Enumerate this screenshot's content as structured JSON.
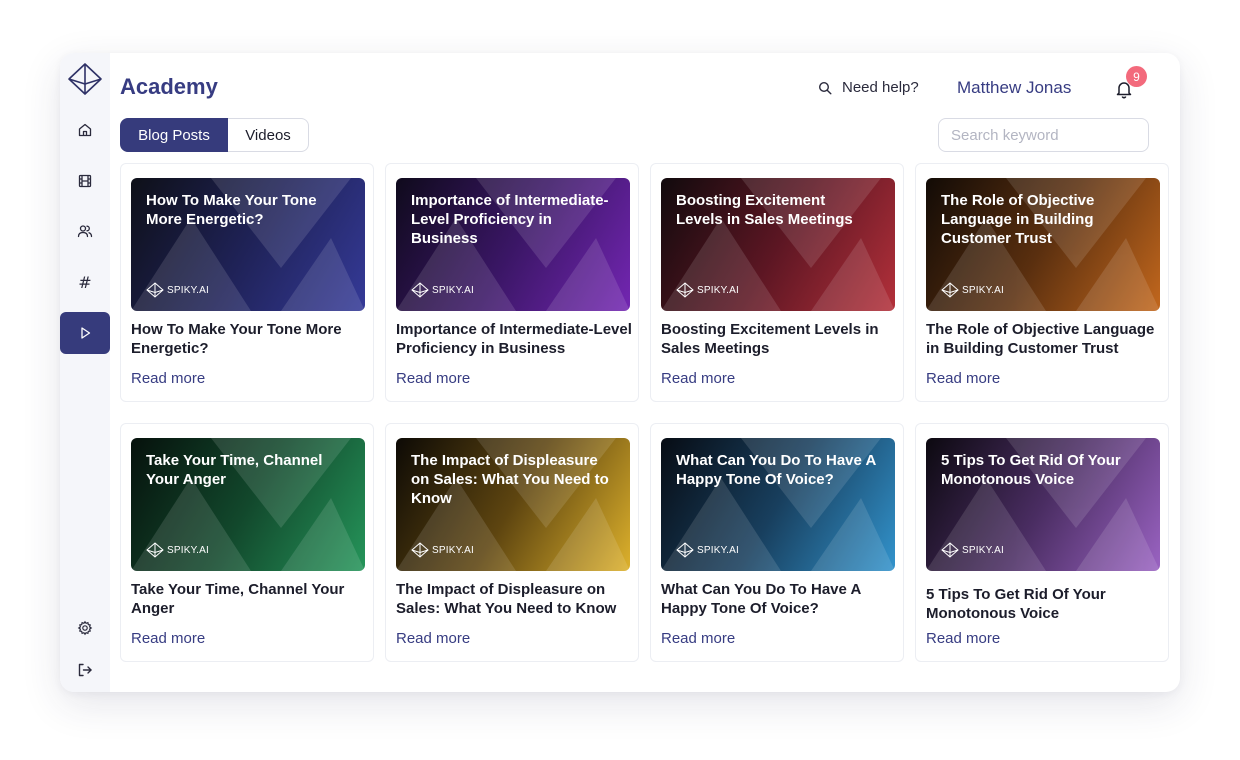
{
  "app": {
    "title": "Academy"
  },
  "header": {
    "help_label": "Need help?",
    "user_name": "Matthew Jonas",
    "notification_count": "9"
  },
  "tabs": [
    {
      "label": "Blog Posts",
      "active": true
    },
    {
      "label": "Videos",
      "active": false
    }
  ],
  "search": {
    "placeholder": "Search keyword",
    "value": ""
  },
  "sidebar": {
    "items": [
      {
        "icon": "home-icon"
      },
      {
        "icon": "film-icon"
      },
      {
        "icon": "users-icon"
      },
      {
        "icon": "hash-icon",
        "glyph": "#"
      },
      {
        "icon": "play-icon",
        "active": true
      }
    ],
    "bottom": [
      {
        "icon": "settings-icon"
      },
      {
        "icon": "logout-icon"
      }
    ]
  },
  "brand": {
    "name": "SPIKY.AI"
  },
  "posts": [
    {
      "thumb_title": "How To Make Your Tone More Energetic?",
      "title": "How To Make Your Tone More Energetic?",
      "link": "Read more",
      "color": "#353a98"
    },
    {
      "thumb_title": "Importance of Intermediate-Level Proficiency in Business",
      "title": "Importance of Intermediate-Level Proficiency in Business",
      "link": "Read more",
      "color": "#7326b2"
    },
    {
      "thumb_title": "Boosting Excitement Levels in Sales Meetings",
      "title": "Boosting Excitement Levels in Sales Meetings",
      "link": "Read more",
      "color": "#b3303a"
    },
    {
      "thumb_title": "The Role of Objective Language in Building Customer Trust",
      "title": "The Role of Objective Language in Building Customer Trust",
      "link": "Read more",
      "color": "#c2671d"
    },
    {
      "thumb_title": "Take Your Time, Channel Your Anger",
      "title": "Take Your Time, Channel Your Anger",
      "link": "Read more",
      "color": "#25955a"
    },
    {
      "thumb_title": "The Impact of Displeasure on Sales: What You Need to Know",
      "title": "The Impact of Displeasure on Sales: What You Need to Know",
      "link": "Read more",
      "color": "#ddb12c"
    },
    {
      "thumb_title": "What Can You Do To Have A Happy Tone Of Voice?",
      "title": "What Can You Do To Have A Happy Tone Of Voice?",
      "link": "Read more",
      "color": "#3293cc"
    },
    {
      "thumb_title": "5 Tips To Get Rid Of Your Monotonous Voice",
      "title": "5 Tips To Get Rid Of Your Monotonous Voice",
      "link": "Read more",
      "color": "#9a63c2"
    }
  ]
}
